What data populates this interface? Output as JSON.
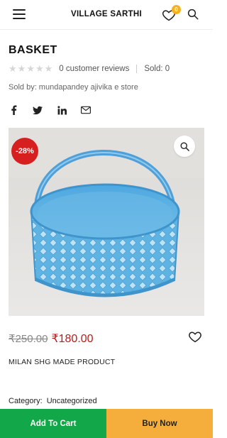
{
  "header": {
    "logo_text": "VILLAGE SARTHI",
    "wishlist_count": "0"
  },
  "product": {
    "title": "BASKET",
    "rating": {
      "stars": 0,
      "max_stars": 5,
      "reviews_text": "0 customer reviews",
      "sold_text": "Sold: 0"
    },
    "seller_text": "Sold by: mundapandey ajivika e store",
    "share_icons": [
      "facebook-icon",
      "twitter-icon",
      "linkedin-icon",
      "email-icon"
    ],
    "discount_badge": "-28%",
    "old_price": "₹250.00",
    "new_price": "₹180.00",
    "description": "MILAN SHG MADE PRODUCT",
    "category_label": "Category:",
    "category_value": "Uncategorized"
  },
  "actions": {
    "add_to_cart": "Add To Cart",
    "buy_now": "Buy Now"
  },
  "colors": {
    "discount": "#d81f1f",
    "price": "#c01818",
    "cart_button": "#12a84a",
    "buy_button": "#f5ad3c",
    "badge": "#f5b21a",
    "basket": "#5fb3e3"
  }
}
